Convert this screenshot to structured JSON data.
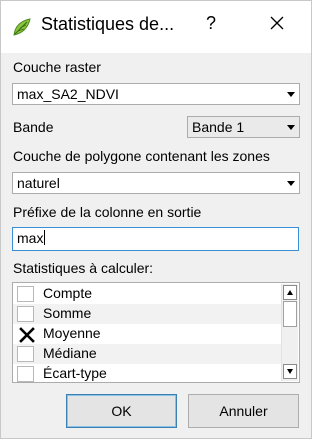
{
  "window": {
    "title": "Statistiques de...",
    "help_glyph": "?",
    "close_icon": "close-icon",
    "app_icon": "qgis-icon"
  },
  "raster_layer": {
    "label": "Couche raster",
    "value": "max_SA2_NDVI"
  },
  "band": {
    "label": "Bande",
    "value": "Bande 1"
  },
  "polygon_layer": {
    "label": "Couche de polygone contenant les zones",
    "value": "naturel"
  },
  "prefix": {
    "label": "Préfixe de la colonne en sortie",
    "value": "max"
  },
  "statistics": {
    "label": "Statistiques à calculer:",
    "items": [
      {
        "label": "Compte",
        "checked": false
      },
      {
        "label": "Somme",
        "checked": false
      },
      {
        "label": "Moyenne",
        "checked": true
      },
      {
        "label": "Médiane",
        "checked": false
      },
      {
        "label": "Écart-type",
        "checked": false
      }
    ]
  },
  "buttons": {
    "ok": "OK",
    "cancel": "Annuler"
  },
  "colors": {
    "focus_border": "#3a8fd8",
    "dialog_bg": "#f0f0f0",
    "default_button_border": "#3c7fb1"
  }
}
